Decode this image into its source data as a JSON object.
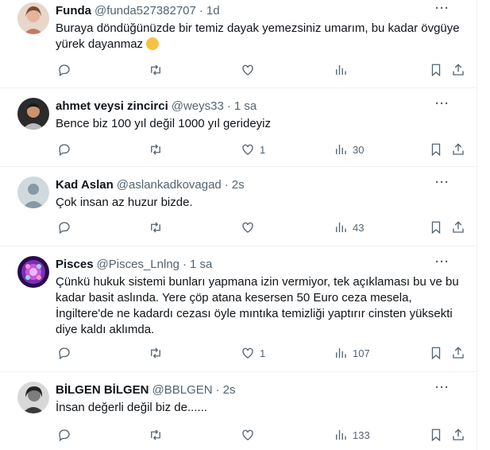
{
  "tweets": [
    {
      "name": "Funda",
      "handle": "@funda527382707",
      "time": "1d",
      "text": "Buraya döndüğünüzde bir temiz dayak yemezsiniz umarım, bu kadar övgüye yürek dayanmaz",
      "emoji": "face-with-hand-over-mouth",
      "likes": "",
      "views": "",
      "avatar_color": "#d9a38f"
    },
    {
      "name": "ahmet veysi zincirci",
      "handle": "@weys33",
      "time": "1 sa",
      "text": "Bence biz 100 yıl değil 1000 yıl gerideyiz",
      "likes": "1",
      "views": "30",
      "avatar_color": "#5a4636"
    },
    {
      "name": "Kad Aslan",
      "handle": "@aslankadkovagad",
      "time": "2s",
      "text": "Çok insan az huzur bizde.",
      "likes": "",
      "views": "43",
      "avatar_color": "#cfd9de"
    },
    {
      "name": "Pisces",
      "handle": "@Pisces_Lnlng",
      "time": "1 sa",
      "text": "Çünkü hukuk sistemi bunları yapmana izin vermiyor, tek açıklaması bu ve bu kadar basit aslında. Yere çöp atana kesersen 50 Euro ceza mesela, İngiltere'de ne kadardı cezası öyle mıntıka temizliği yaptırır cinsten yüksekti diye kaldı aklımda.",
      "likes": "1",
      "views": "107",
      "avatar_color": "#6a2c9a"
    },
    {
      "name": "BİLGEN BİLGEN",
      "handle": "@BBLGEN",
      "time": "2s",
      "text": "İnsan değerli değil biz de......",
      "likes": "",
      "views": "133",
      "avatar_color": "#8a8a8a"
    }
  ],
  "more_label": "···"
}
